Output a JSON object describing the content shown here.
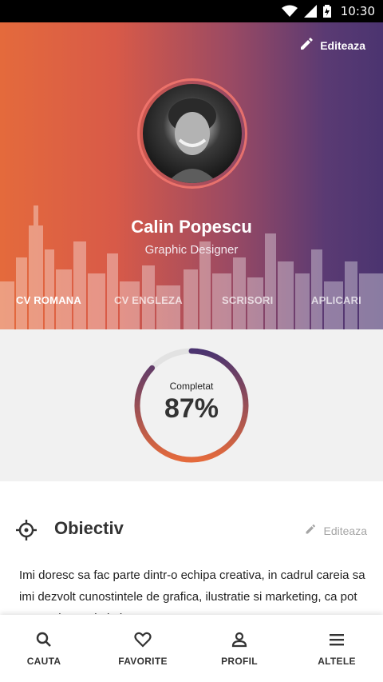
{
  "status_bar": {
    "time": "10:30"
  },
  "header": {
    "edit_label": "Editeaza",
    "name": "Calin Popescu",
    "role": "Graphic Designer",
    "tabs": [
      {
        "label": "CV ROMANA",
        "active": true
      },
      {
        "label": "CV ENGLEZA",
        "active": false
      },
      {
        "label": "SCRISORI",
        "active": false
      },
      {
        "label": "APLICARI",
        "active": false
      }
    ]
  },
  "progress": {
    "label": "Completat",
    "value_text": "87%",
    "value": 0.87
  },
  "objective": {
    "title": "Obiectiv",
    "edit_label": "Editeaza",
    "text": "Imi doresc sa fac parte dintr-o echipa creativa, in cadrul careia sa imi dezvolt cunostintele de grafica, ilustratie si marketing, ca pot crea valoare si altele."
  },
  "bottom_nav": [
    {
      "label": "CAUTA",
      "icon": "search-icon"
    },
    {
      "label": "FAVORITE",
      "icon": "heart-icon"
    },
    {
      "label": "PROFIL",
      "icon": "person-icon"
    },
    {
      "label": "ALTELE",
      "icon": "menu-icon"
    }
  ],
  "colors": {
    "gradient_start": "#e46a3c",
    "gradient_end": "#4b3470",
    "progress_track": "#e2e2e2"
  }
}
